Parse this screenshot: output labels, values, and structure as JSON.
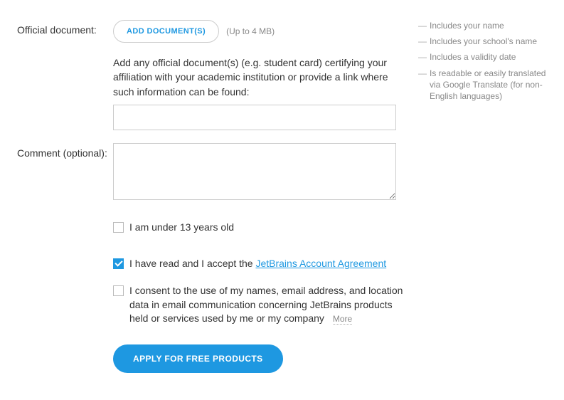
{
  "document": {
    "label": "Official document:",
    "addButton": "ADD DOCUMENT(S)",
    "sizeHint": "(Up to 4 MB)",
    "description": "Add any official document(s) (e.g. student card) certifying your affiliation with your academic institution or provide a link where such information can be found:",
    "inputValue": ""
  },
  "requirements": {
    "items": [
      "Includes your name",
      "Includes your school's name",
      "Includes a validity date",
      "Is readable or easily translated via Google Translate (for non-English languages)"
    ]
  },
  "comment": {
    "label": "Comment (optional):",
    "value": ""
  },
  "checkboxes": {
    "under13": {
      "label": "I am under 13 years old",
      "checked": false
    },
    "agreement": {
      "prefix": "I have read and I accept the ",
      "linkText": "JetBrains Account Agreement",
      "checked": true
    },
    "consent": {
      "label": "I consent to the use of my names, email address, and location data in email communication concerning JetBrains products held or services used by me or my company",
      "moreLabel": "More",
      "checked": false
    }
  },
  "submit": {
    "label": "APPLY FOR FREE PRODUCTS"
  }
}
